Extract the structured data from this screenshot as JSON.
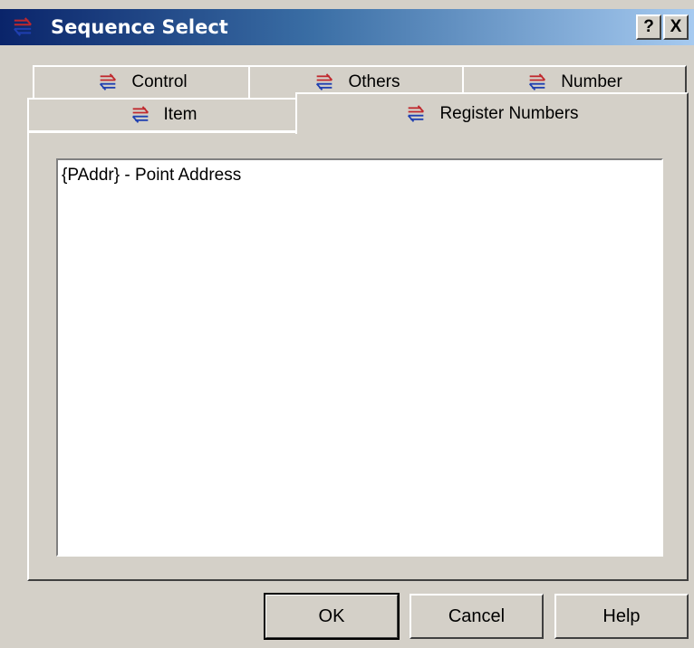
{
  "window": {
    "title": "Sequence Select",
    "help_label": "?",
    "close_label": "X"
  },
  "tabs": {
    "row_back": [
      {
        "label": "Control",
        "icon": "swap-arrows-icon"
      },
      {
        "label": "Others",
        "icon": "swap-arrows-icon"
      },
      {
        "label": "Number",
        "icon": "swap-arrows-icon"
      }
    ],
    "row_front": [
      {
        "label": "Item",
        "icon": "swap-arrows-icon"
      },
      {
        "label": "Register Numbers",
        "icon": "swap-arrows-icon",
        "selected": true
      }
    ]
  },
  "list": {
    "items": [
      "{PAddr} - Point Address"
    ]
  },
  "buttons": {
    "ok": "OK",
    "cancel": "Cancel",
    "help": "Help"
  },
  "colors": {
    "title_start": "#0a246a",
    "title_end": "#a6caf0",
    "face": "#d4d0c8",
    "icon_red": "#c0282d",
    "icon_blue": "#1f3fb0"
  }
}
